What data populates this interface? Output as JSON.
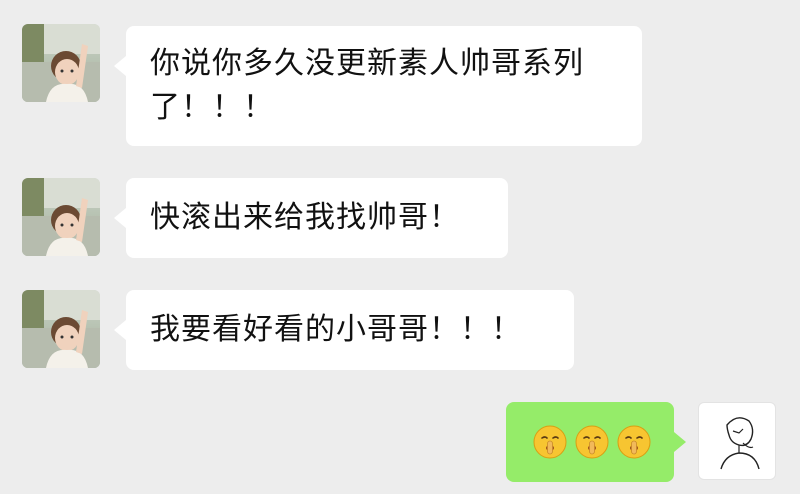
{
  "chat": {
    "messages": [
      {
        "sender": "other",
        "text_line1": "你说你多久没更新素人帅哥系列",
        "text_line2": "了！！！"
      },
      {
        "sender": "other",
        "text": "快滚出来给我找帅哥！"
      },
      {
        "sender": "other",
        "text": "我要看好看的小哥哥！！！"
      },
      {
        "sender": "self",
        "emojis": [
          "shushing-face-emoji",
          "shushing-face-emoji",
          "shushing-face-emoji"
        ]
      }
    ]
  },
  "colors": {
    "background": "#ededed",
    "incoming_bubble": "#ffffff",
    "outgoing_bubble": "#95ec69"
  }
}
